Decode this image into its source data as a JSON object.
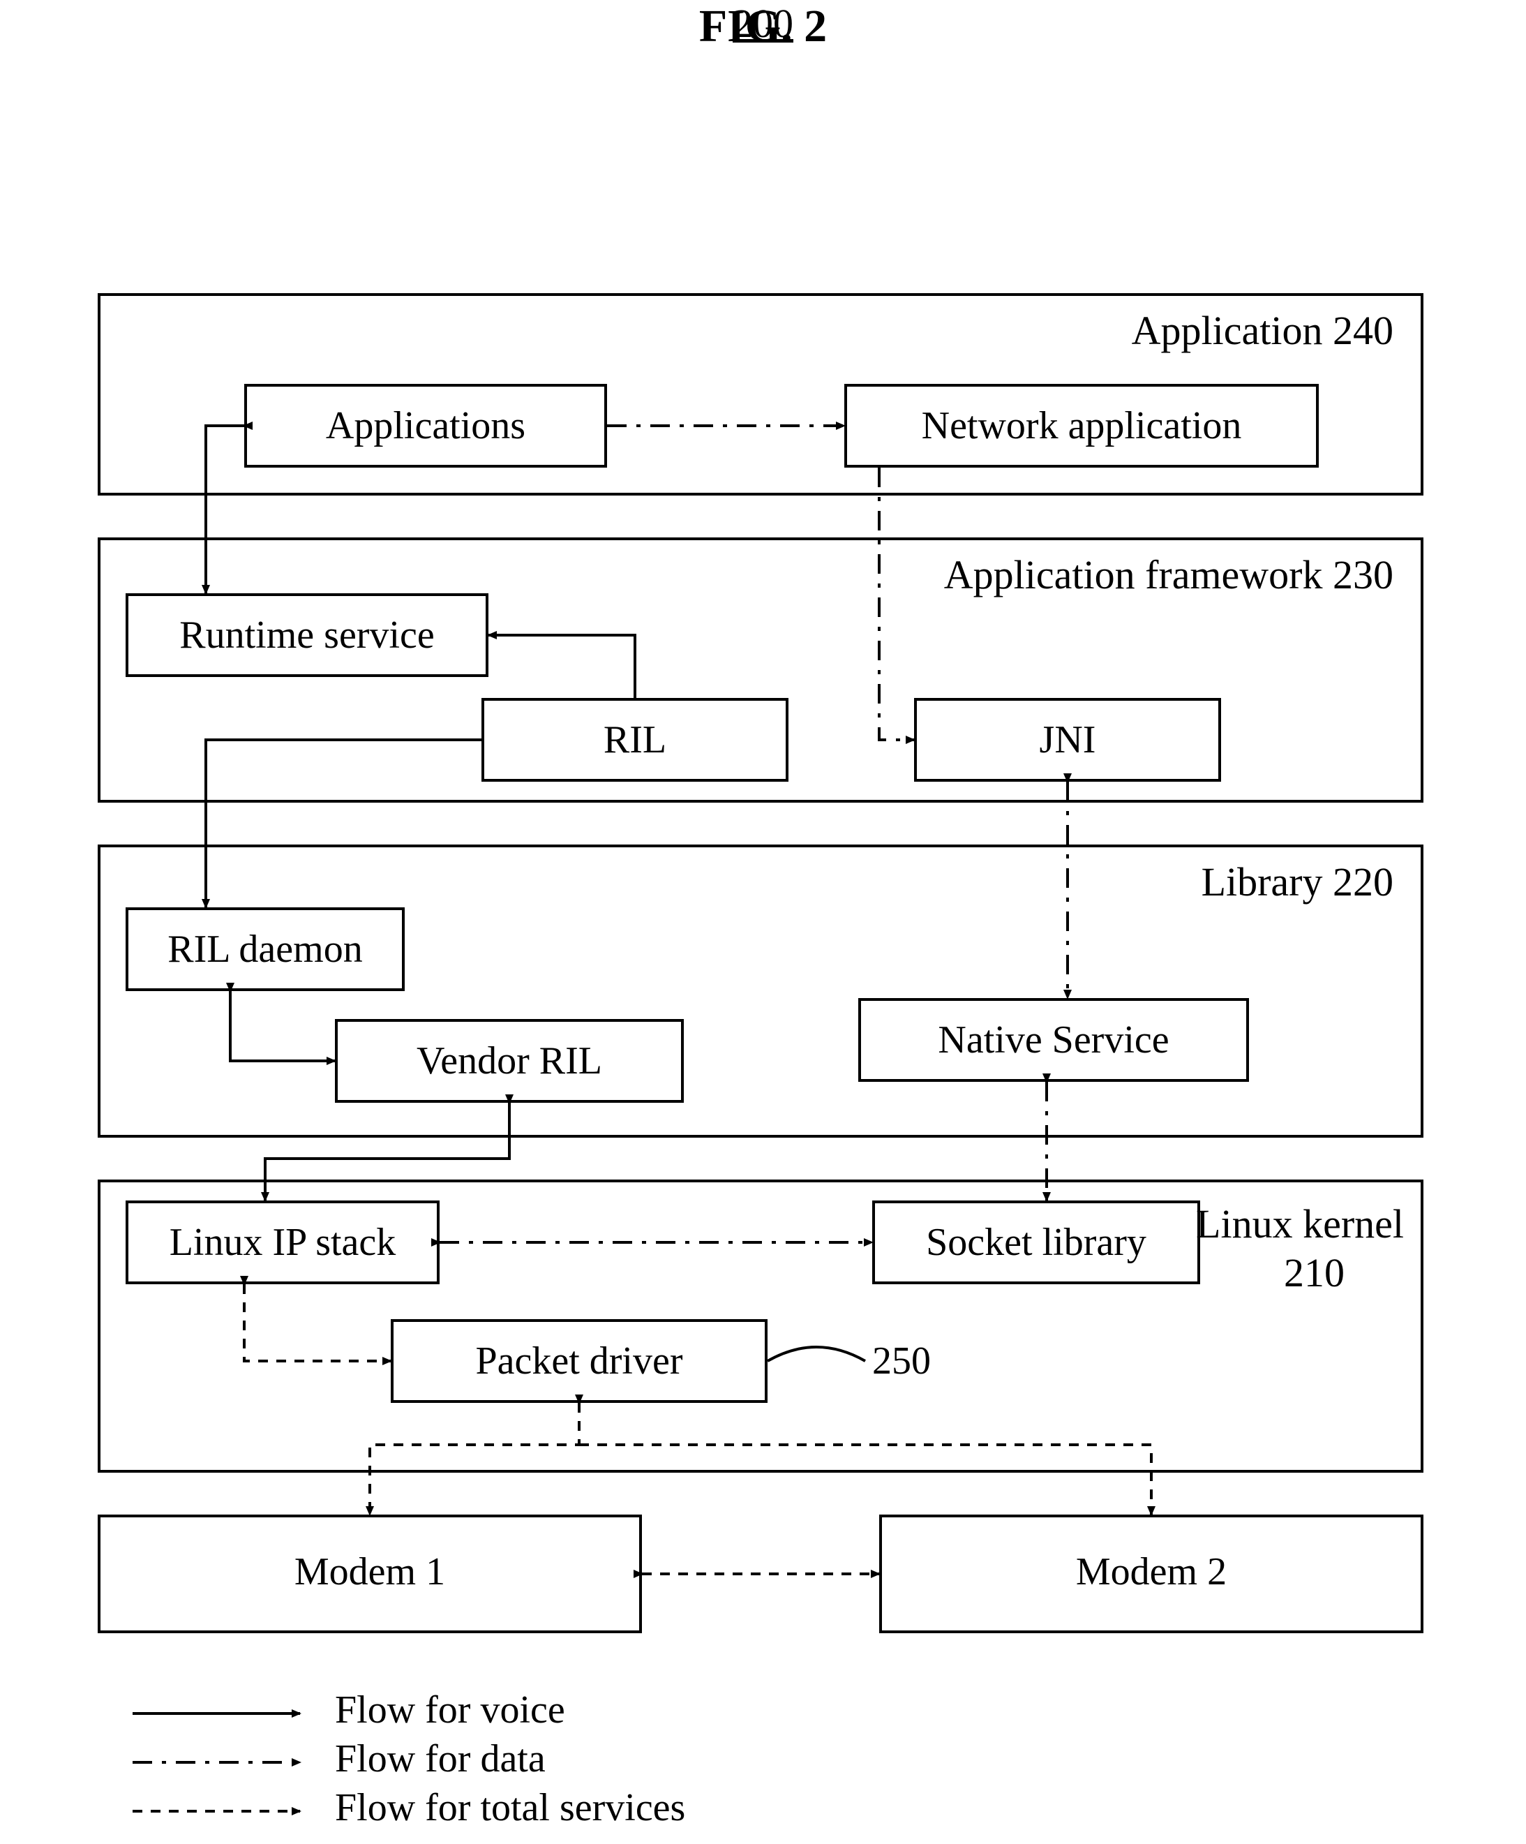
{
  "figure_label": "FIG. 2",
  "figure_ref": "200",
  "layers": {
    "application": {
      "label": "Application 240"
    },
    "application_fw": {
      "label": "Application framework 230"
    },
    "library": {
      "label": "Library 220"
    },
    "linux_kernel": {
      "label_a": "Linux kernel",
      "label_b": "210"
    }
  },
  "blocks": {
    "applications": "Applications",
    "network_app": "Network application",
    "runtime_service": "Runtime service",
    "ril": "RIL",
    "jni": "JNI",
    "ril_daemon": "RIL daemon",
    "vendor_ril": "Vendor RIL",
    "native_service": "Native Service",
    "linux_ip_stack": "Linux IP stack",
    "socket_library": "Socket library",
    "packet_driver": "Packet driver",
    "modem1": "Modem 1",
    "modem2": "Modem 2"
  },
  "packet_driver_ref": "250",
  "legend": {
    "voice": "Flow for voice",
    "data": "Flow for data",
    "total": "Flow for total services"
  },
  "flows": [
    {
      "from": "Applications",
      "to": "Runtime service",
      "type": "voice",
      "dir": "bi"
    },
    {
      "from": "Runtime service",
      "to": "RIL",
      "type": "voice",
      "dir": "bi"
    },
    {
      "from": "RIL",
      "to": "RIL daemon",
      "type": "voice",
      "dir": "uni"
    },
    {
      "from": "RIL daemon",
      "to": "Vendor RIL",
      "type": "voice",
      "dir": "bi"
    },
    {
      "from": "Vendor RIL",
      "to": "Linux IP stack",
      "type": "voice",
      "dir": "bi"
    },
    {
      "from": "Applications",
      "to": "Network application",
      "type": "data",
      "dir": "uni"
    },
    {
      "from": "Network application",
      "to": "JNI",
      "via": "RIL",
      "type": "data",
      "dir": "uni"
    },
    {
      "from": "JNI",
      "to": "Native Service",
      "type": "data",
      "dir": "bi"
    },
    {
      "from": "Native Service",
      "to": "Socket library",
      "type": "data",
      "dir": "bi"
    },
    {
      "from": "Socket library",
      "to": "Linux IP stack",
      "type": "data",
      "dir": "bi"
    },
    {
      "from": "Linux IP stack",
      "to": "Packet driver",
      "type": "total",
      "dir": "bi"
    },
    {
      "from": "Packet driver",
      "to": "Modem 1",
      "type": "total",
      "dir": "bi"
    },
    {
      "from": "Packet driver",
      "to": "Modem 2",
      "type": "total",
      "dir": "bi"
    },
    {
      "from": "Modem 1",
      "to": "Modem 2",
      "type": "total",
      "dir": "bi"
    }
  ]
}
